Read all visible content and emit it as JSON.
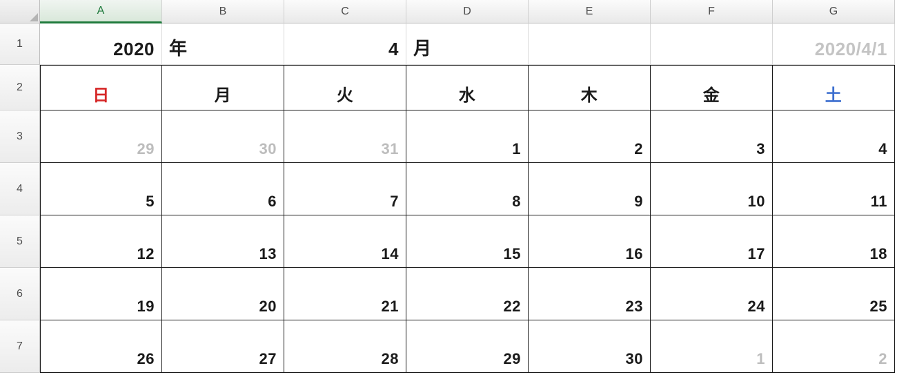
{
  "columns": [
    "A",
    "B",
    "C",
    "D",
    "E",
    "F",
    "G"
  ],
  "active_column_index": 0,
  "row_labels": [
    "1",
    "2",
    "3",
    "4",
    "5",
    "6",
    "7"
  ],
  "row1": {
    "year": "2020",
    "year_label": "年",
    "month": "4",
    "month_label": "月",
    "date_text": "2020/4/1"
  },
  "days_of_week": [
    "日",
    "月",
    "火",
    "水",
    "木",
    "金",
    "土"
  ],
  "calendar": [
    [
      {
        "v": "29",
        "dim": true
      },
      {
        "v": "30",
        "dim": true
      },
      {
        "v": "31",
        "dim": true
      },
      {
        "v": "1",
        "dim": false
      },
      {
        "v": "2",
        "dim": false
      },
      {
        "v": "3",
        "dim": false
      },
      {
        "v": "4",
        "dim": false
      }
    ],
    [
      {
        "v": "5",
        "dim": false
      },
      {
        "v": "6",
        "dim": false
      },
      {
        "v": "7",
        "dim": false
      },
      {
        "v": "8",
        "dim": false
      },
      {
        "v": "9",
        "dim": false
      },
      {
        "v": "10",
        "dim": false
      },
      {
        "v": "11",
        "dim": false
      }
    ],
    [
      {
        "v": "12",
        "dim": false
      },
      {
        "v": "13",
        "dim": false
      },
      {
        "v": "14",
        "dim": false
      },
      {
        "v": "15",
        "dim": false
      },
      {
        "v": "16",
        "dim": false
      },
      {
        "v": "17",
        "dim": false
      },
      {
        "v": "18",
        "dim": false
      }
    ],
    [
      {
        "v": "19",
        "dim": false
      },
      {
        "v": "20",
        "dim": false
      },
      {
        "v": "21",
        "dim": false
      },
      {
        "v": "22",
        "dim": false
      },
      {
        "v": "23",
        "dim": false
      },
      {
        "v": "24",
        "dim": false
      },
      {
        "v": "25",
        "dim": false
      }
    ],
    [
      {
        "v": "26",
        "dim": false
      },
      {
        "v": "27",
        "dim": false
      },
      {
        "v": "28",
        "dim": false
      },
      {
        "v": "29",
        "dim": false
      },
      {
        "v": "30",
        "dim": false
      },
      {
        "v": "1",
        "dim": true
      },
      {
        "v": "2",
        "dim": true
      }
    ]
  ]
}
